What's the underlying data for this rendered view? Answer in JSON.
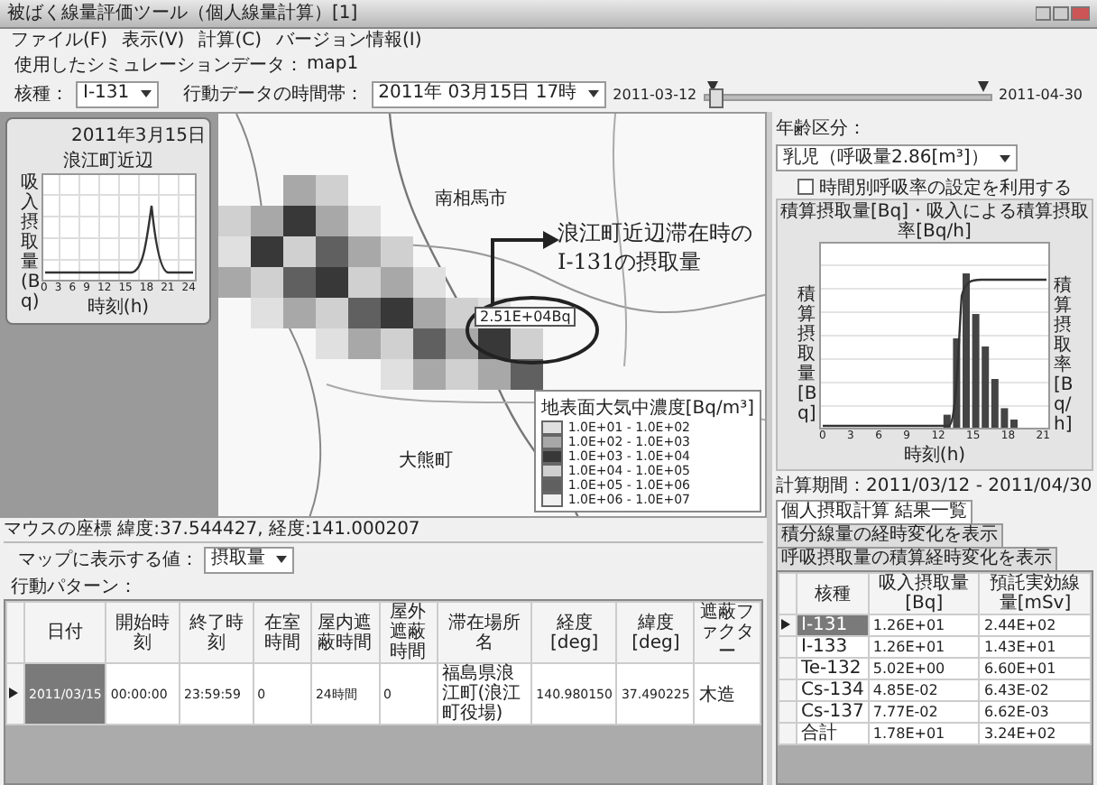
{
  "window": {
    "title": "被ばく線量評価ツール（個人線量計算）[1]"
  },
  "menu": [
    "ファイル(F)",
    "表示(V)",
    "計算(C)",
    "バージョン情報(I)"
  ],
  "simulation_data": {
    "label": "使用したシミュレーションデータ：",
    "value": "map1"
  },
  "nuclide": {
    "label": "核種：",
    "value": "I-131"
  },
  "time_range": {
    "label": "行動データの時間帯：",
    "value": "2011年 03月15日 17時",
    "start": "2011-03-12",
    "end": "2011-04-30",
    "level": 0.03
  },
  "small_chart": {
    "title": "浪江町近辺",
    "date": "2011年3月15日",
    "ylabel": "吸入摂取量(Bq)",
    "xlabel": "時刻(h)",
    "xticks": [
      "0",
      "3",
      "6",
      "9",
      "12",
      "15",
      "18",
      "21",
      "24"
    ]
  },
  "map": {
    "places": [
      {
        "name": "南相馬市"
      },
      {
        "name": "大熊町"
      }
    ],
    "annotation_lines": [
      "浪江町近辺滞在時の",
      "I-131の摂取量"
    ],
    "tooltip": "2.51E+04Bq",
    "legend": {
      "title": "地表面大気中濃度[Bq/m³]",
      "entries": [
        {
          "label": "1.0E+01 - 1.0E+02",
          "color": "#e0e0e0"
        },
        {
          "label": "1.0E+02 - 1.0E+03",
          "color": "#a8a8a8"
        },
        {
          "label": "1.0E+03 - 1.0E+04",
          "color": "#383838"
        },
        {
          "label": "1.0E+04 - 1.0E+05",
          "color": "#d0d0d0"
        },
        {
          "label": "1.0E+05 - 1.0E+06",
          "color": "#606060"
        },
        {
          "label": "1.0E+06 - 1.0E+07",
          "color": "#f0f0f0"
        }
      ]
    }
  },
  "mouse_coords": "マウスの座標 緯度:37.544427, 経度:141.000207",
  "map_value": {
    "label": "マップに表示する値：",
    "value": "摂取量"
  },
  "behavior_pattern": {
    "label": "行動パターン：",
    "columns": [
      "日付",
      "開始時刻",
      "終了時刻",
      "在室時間",
      "屋内遮蔽時間",
      "屋外遮蔽時間",
      "滞在場所名",
      "経度[deg]",
      "緯度[deg]",
      "遮蔽ファクター"
    ],
    "rows": [
      {
        "selected": true,
        "cells": [
          "2011/03/15",
          "00:00:00",
          "23:59:59",
          "0",
          "24時間",
          "0",
          "福島県浪江町(浪江町役場)",
          "140.980150",
          "37.490225",
          "木造"
        ]
      }
    ]
  },
  "age_group": {
    "label": "年齢区分：",
    "value": "乳児（呼吸量2.86[m³]）"
  },
  "hourly_rate": {
    "label": "時間別呼吸率の設定を利用する",
    "checked": false
  },
  "intake_chart": {
    "title": "積算摂取量[Bq]・吸入による積算摂取率[Bq/h]",
    "ylabel": "積算摂取量[Bq]",
    "y2label": "積算摂取率[Bq/h]",
    "xlabel": "時刻(h)",
    "xticks": [
      "0",
      "3",
      "6",
      "9",
      "12",
      "15",
      "18",
      "21"
    ]
  },
  "period": "計算期間：2011/03/12 - 2011/04/30",
  "result_tabs": [
    {
      "label": "個人摂取計算 結果一覧",
      "selected": true
    },
    {
      "label": "積分線量の経時変化を表示",
      "selected": false
    },
    {
      "label": "呼吸摂取量の積算経時変化を表示",
      "selected": false
    }
  ],
  "results": {
    "columns": [
      "核種",
      "吸入摂取量[Bq]",
      "預託実効線量[mSv]"
    ],
    "rows": [
      {
        "selected": true,
        "cells": [
          "I-131",
          "1.26E+01",
          "2.44E+02"
        ]
      },
      {
        "selected": false,
        "cells": [
          "I-133",
          "1.26E+01",
          "1.43E+01"
        ]
      },
      {
        "selected": false,
        "cells": [
          "Te-132",
          "5.02E+00",
          "6.60E+01"
        ]
      },
      {
        "selected": false,
        "cells": [
          "Cs-134",
          "4.85E-02",
          "6.43E-02"
        ]
      },
      {
        "selected": false,
        "cells": [
          "Cs-137",
          "7.77E-02",
          "6.62E-03"
        ]
      },
      {
        "selected": false,
        "cells": [
          "合計",
          "1.78E+01",
          "3.24E+02"
        ]
      }
    ]
  }
}
